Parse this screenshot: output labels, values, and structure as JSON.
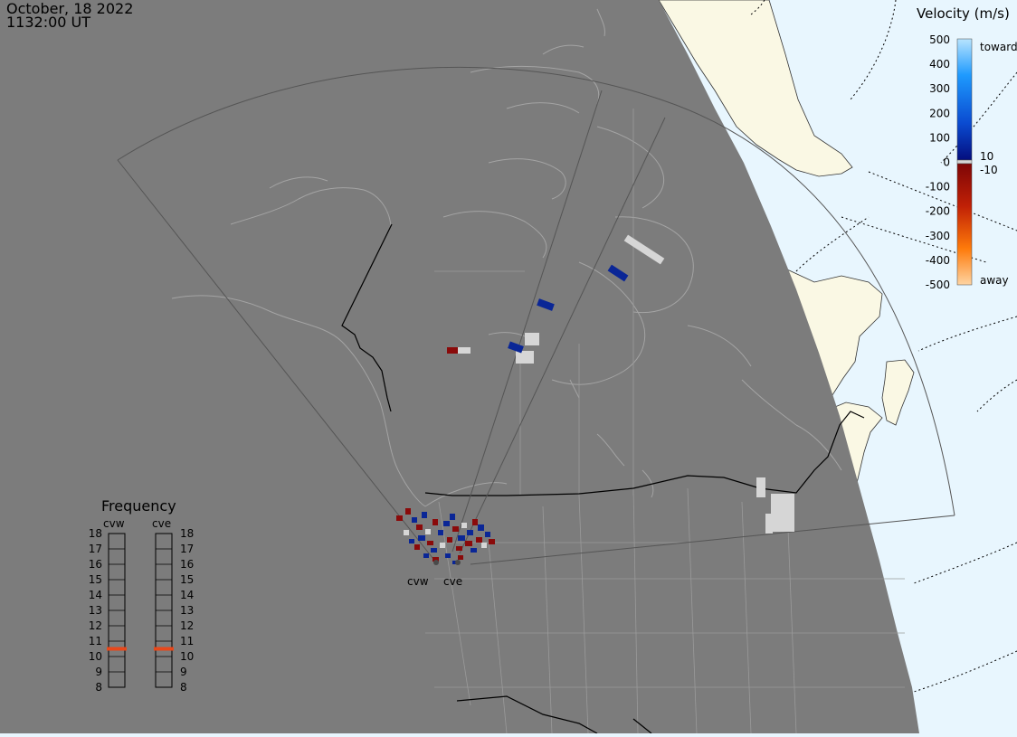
{
  "header": {
    "date": "October, 18 2022",
    "time": "1132:00 UT"
  },
  "colors": {
    "night": "#7c7c7c",
    "day_ocean": "#e8f6fe",
    "day_land": "#faf8e4",
    "coast_night": "#a4a4a4",
    "fov_line": "#555555",
    "ground_scatter": "#d6d6d6",
    "freq_marker": "#e8481b"
  },
  "velocity_scale": {
    "title": "Velocity (m/s)",
    "ticks": [
      "500",
      "400",
      "300",
      "200",
      "100",
      "0",
      "-100",
      "-200",
      "-300",
      "-400",
      "-500"
    ],
    "toward_label": "toward",
    "away_label": "away",
    "inner_pos": "10",
    "inner_neg": "-10"
  },
  "radars": [
    {
      "code": "cvw",
      "frequency_mhz": 10.5
    },
    {
      "code": "cve",
      "frequency_mhz": 10.5
    }
  ],
  "frequency_panel": {
    "title": "Frequency",
    "scale": [
      "18",
      "17",
      "16",
      "15",
      "14",
      "13",
      "12",
      "11",
      "10",
      "9",
      "8"
    ]
  }
}
